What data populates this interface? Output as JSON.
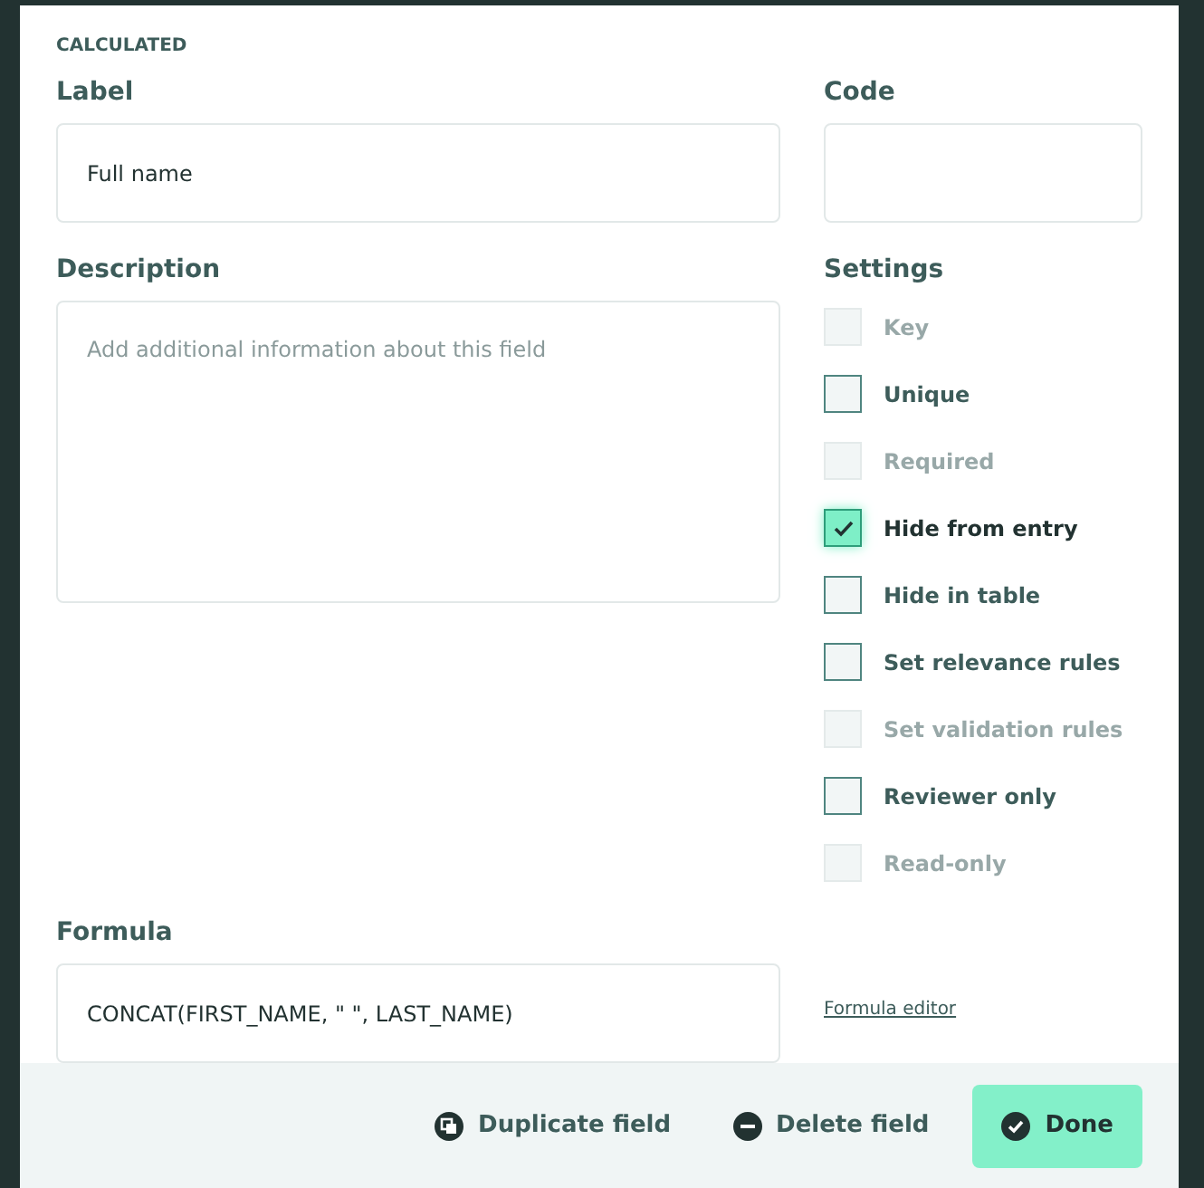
{
  "section_label": "CALCULATED",
  "label_field": {
    "label": "Label",
    "value": "Full name"
  },
  "code_field": {
    "label": "Code"
  },
  "description_field": {
    "label": "Description",
    "placeholder": "Add additional information about this field"
  },
  "settings": {
    "title": "Settings",
    "items": [
      {
        "label": "Key",
        "checked": false,
        "disabled": true
      },
      {
        "label": "Unique",
        "checked": false,
        "disabled": false
      },
      {
        "label": "Required",
        "checked": false,
        "disabled": true
      },
      {
        "label": "Hide from entry",
        "checked": true,
        "disabled": false
      },
      {
        "label": "Hide in table",
        "checked": false,
        "disabled": false
      },
      {
        "label": "Set relevance rules",
        "checked": false,
        "disabled": false
      },
      {
        "label": "Set validation rules",
        "checked": false,
        "disabled": true
      },
      {
        "label": "Reviewer only",
        "checked": false,
        "disabled": false
      },
      {
        "label": "Read-only",
        "checked": false,
        "disabled": true
      }
    ]
  },
  "formula_field": {
    "label": "Formula",
    "value": "CONCAT(FIRST_NAME, \" \", LAST_NAME)"
  },
  "formula_editor_link": "Formula editor",
  "footer": {
    "duplicate": "Duplicate field",
    "delete": "Delete field",
    "done": "Done"
  }
}
